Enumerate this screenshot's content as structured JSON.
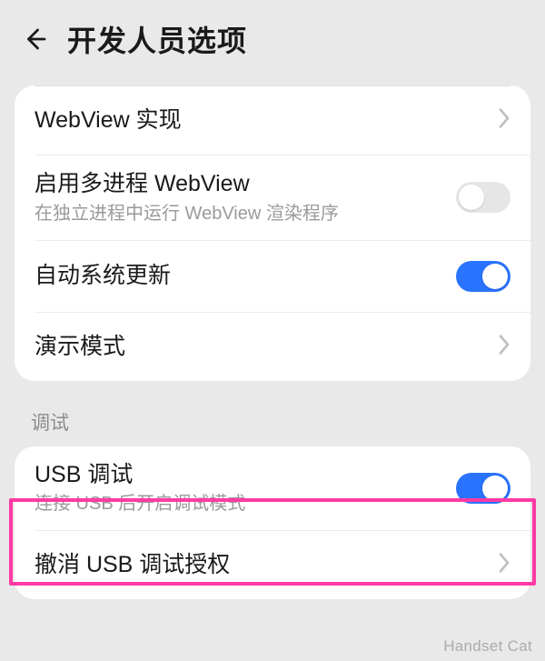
{
  "header": {
    "title": "开发人员选项"
  },
  "group1": {
    "items": [
      {
        "title": "WebView 实现",
        "sub": null,
        "type": "link"
      },
      {
        "title": "启用多进程 WebView",
        "sub": "在独立进程中运行 WebView 渲染程序",
        "type": "toggle",
        "on": false
      },
      {
        "title": "自动系统更新",
        "sub": null,
        "type": "toggle",
        "on": true
      },
      {
        "title": "演示模式",
        "sub": null,
        "type": "link"
      }
    ]
  },
  "section_debug": {
    "label": "调试"
  },
  "group2": {
    "items": [
      {
        "title": "USB 调试",
        "sub": "连接 USB 后开启调试模式",
        "type": "toggle",
        "on": true
      },
      {
        "title": "撤消 USB 调试授权",
        "sub": null,
        "type": "link"
      }
    ]
  },
  "colors": {
    "accent": "#2a73ff",
    "highlight": "#ff3aa4"
  },
  "watermark": "Handset Cat"
}
